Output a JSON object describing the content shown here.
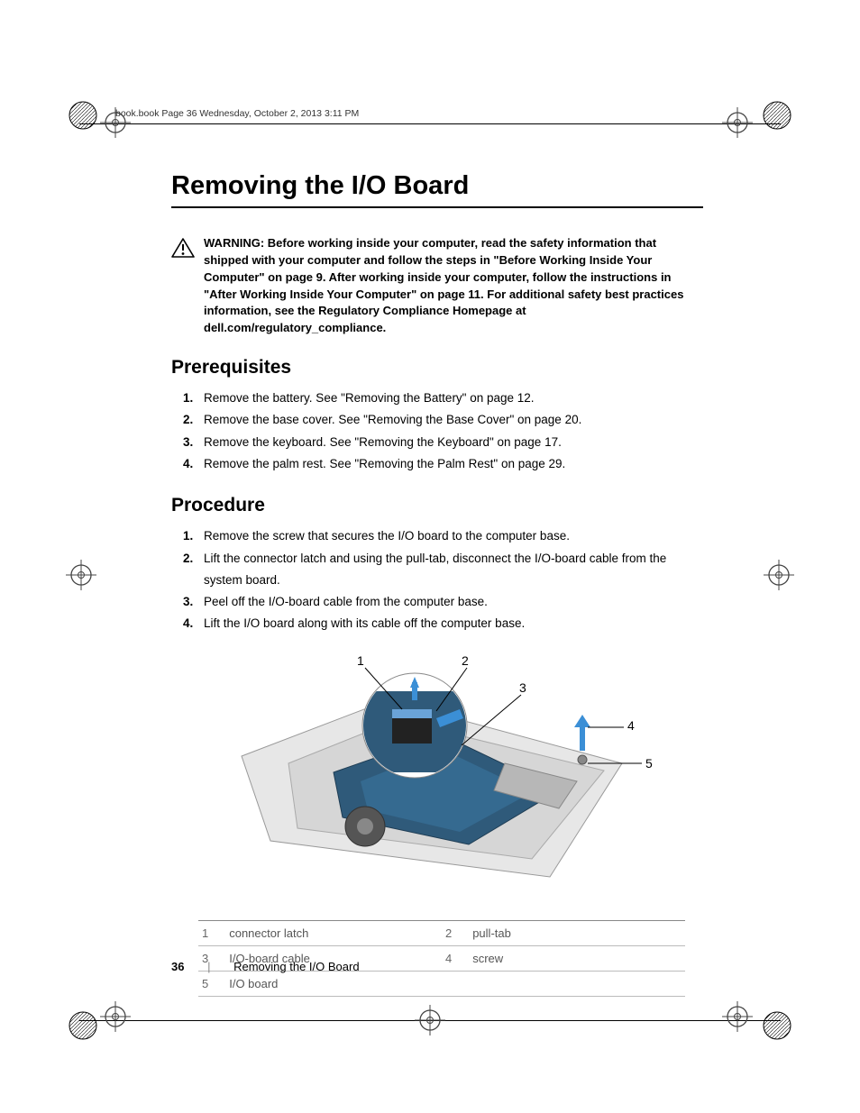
{
  "header_runner": "book.book  Page 36  Wednesday, October 2, 2013  3:11 PM",
  "title": "Removing the I/O Board",
  "warning": {
    "lead": "WARNING:",
    "body": "Before working inside your computer, read the safety information that shipped with your computer and follow the steps in \"Before Working Inside Your Computer\" on page 9. After working inside your computer, follow the instructions in \"After Working Inside Your Computer\" on page 11. For additional safety best practices information, see the Regulatory Compliance Homepage at dell.com/regulatory_compliance."
  },
  "sections": {
    "prerequisites": {
      "heading": "Prerequisites",
      "items": [
        "Remove the battery. See \"Removing the Battery\" on page 12.",
        "Remove the base cover. See \"Removing the Base Cover\" on page 20.",
        "Remove the keyboard. See \"Removing the Keyboard\" on page 17.",
        "Remove the palm rest. See \"Removing the Palm Rest\" on page 29."
      ]
    },
    "procedure": {
      "heading": "Procedure",
      "items": [
        "Remove the screw that secures the I/O board to the computer base.",
        "Lift the connector latch and using the pull-tab, disconnect the I/O-board cable from the system board.",
        "Peel off the I/O-board cable from the computer base.",
        "Lift the I/O board along with its cable off the computer base."
      ]
    }
  },
  "figure_callouts": [
    "1",
    "2",
    "3",
    "4",
    "5"
  ],
  "legend": [
    {
      "n": "1",
      "label": "connector latch"
    },
    {
      "n": "2",
      "label": "pull-tab"
    },
    {
      "n": "3",
      "label": "I/O-board cable"
    },
    {
      "n": "4",
      "label": "screw"
    },
    {
      "n": "5",
      "label": "I/O board"
    }
  ],
  "footer": {
    "pagenum": "36",
    "sep": "|",
    "section": "Removing the I/O Board"
  }
}
